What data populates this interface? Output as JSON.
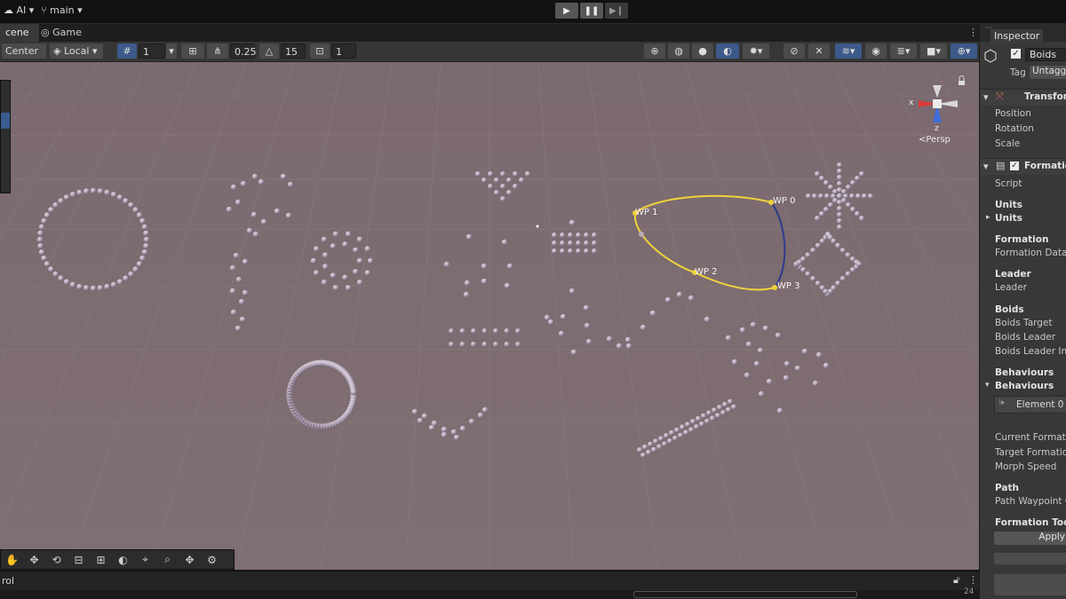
{
  "topbar": {
    "account_label": "AI",
    "branch_label": "main",
    "play_icon": "play-icon",
    "pause_icon": "pause-icon",
    "step_icon": "step-icon"
  },
  "tabs": [
    {
      "label": "cene"
    },
    {
      "label": "Game"
    }
  ],
  "scene_toolbar": {
    "pivot_mode": "Center",
    "pivot_rotation": "Local",
    "grid_value": "1",
    "snap_increment": "0.25",
    "rotate_snap": "15",
    "scale_snap": "1"
  },
  "viewport": {
    "gizmo": {
      "x_label": "x",
      "z_label": "z",
      "view_label": "<Persp"
    },
    "waypoints": [
      {
        "label": "WP 0"
      },
      {
        "label": "WP 1"
      },
      {
        "label": "WP 2"
      },
      {
        "label": "WP 3"
      }
    ]
  },
  "statusbar": {
    "text": "rol",
    "count": "24"
  },
  "inspector": {
    "tab_label": "Inspector",
    "object_name": "Boids",
    "tag_label": "Tag",
    "tag_value": "Untagge",
    "transform": {
      "title": "Transform",
      "fields": [
        "Position",
        "Rotation",
        "Scale"
      ]
    },
    "formation": {
      "title": "Formation",
      "script_label": "Script",
      "units_header": "Units",
      "units_foldout": "Units",
      "formation_header": "Formation",
      "formation_data": "Formation Data",
      "leader_header": "Leader",
      "leader_field": "Leader",
      "boids_header": "Boids",
      "boids_fields": [
        "Boids Target",
        "Boids Leader",
        "Boids Leader Infl"
      ],
      "behaviours_header": "Behaviours",
      "behaviours_foldout": "Behaviours",
      "element_label": "Element 0",
      "morph_fields": [
        "Current Formatio",
        "Target Formatio",
        "Morph Speed"
      ],
      "path_header": "Path",
      "path_field": "Path Waypoint C",
      "tools_header": "Formation Tools",
      "apply_button": "Apply"
    }
  }
}
